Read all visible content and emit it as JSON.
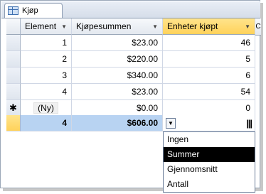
{
  "tab": {
    "label": "Kjøp"
  },
  "columns": [
    {
      "label": "Element"
    },
    {
      "label": "Kjøpesummen"
    },
    {
      "label": "Enheter kjøpt"
    },
    {
      "label": "C"
    }
  ],
  "rows": [
    {
      "element": "1",
      "sum": "$23.00",
      "units": "46"
    },
    {
      "element": "2",
      "sum": "$220.00",
      "units": "5"
    },
    {
      "element": "3",
      "sum": "$340.00",
      "units": "6"
    },
    {
      "element": "4",
      "sum": "$23.00",
      "units": "54"
    }
  ],
  "new_row": {
    "marker": "✱",
    "element": "(Ny)",
    "sum": "$0.00",
    "units": "0"
  },
  "total_row": {
    "element": "4",
    "sum": "$606.00"
  },
  "dropdown": {
    "options": [
      "Ingen",
      "Summer",
      "Gjennomsnitt",
      "Antall"
    ],
    "selected": "Summer"
  }
}
